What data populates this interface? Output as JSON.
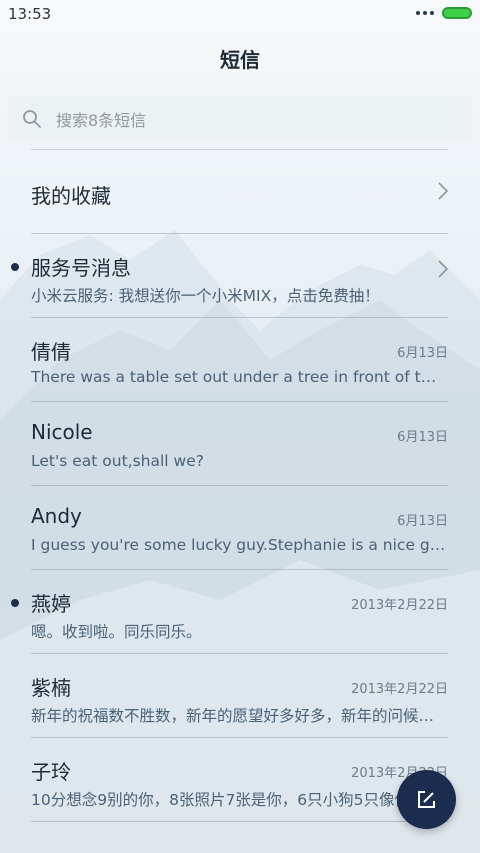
{
  "status_bar": {
    "time": "13:53"
  },
  "header": {
    "title": "短信"
  },
  "search": {
    "placeholder": "搜索8条短信"
  },
  "rows": [
    {
      "name": "我的收藏",
      "has_chevron": true
    },
    {
      "name": "服务号消息",
      "preview": "小米云服务: 我想送你一个小米MIX，点击免费抽！",
      "unread": true,
      "has_chevron": true
    },
    {
      "name": "倩倩",
      "preview": "There was a table set out under a tree in front of the house",
      "date": "6月13日"
    },
    {
      "name": "Nicole",
      "preview": "Let's eat out,shall we?",
      "date": "6月13日"
    },
    {
      "name": "Andy",
      "preview": "I guess you're some lucky guy.Stephanie is a nice girl.",
      "date": "6月13日"
    },
    {
      "name": "燕婷",
      "preview": "嗯。收到啦。同乐同乐。",
      "date": "2013年2月22日",
      "unread": true
    },
    {
      "name": "紫楠",
      "preview": "新年的祝福数不胜数，新年的愿望好多好多，新年的问候真心送上",
      "date": "2013年2月22日"
    },
    {
      "name": "子玲",
      "preview": "10分想念9别的你，8张照片7张是你，6只小狗5只像你",
      "date": "2013年2月22日"
    }
  ],
  "colors": {
    "accent": "#1b2d4e",
    "battery": "#3fcf4a",
    "unread_dot": "#1d2f4c"
  },
  "icons": {
    "search": "search-icon",
    "compose": "compose-icon",
    "chevron": "chevron-right-icon"
  }
}
